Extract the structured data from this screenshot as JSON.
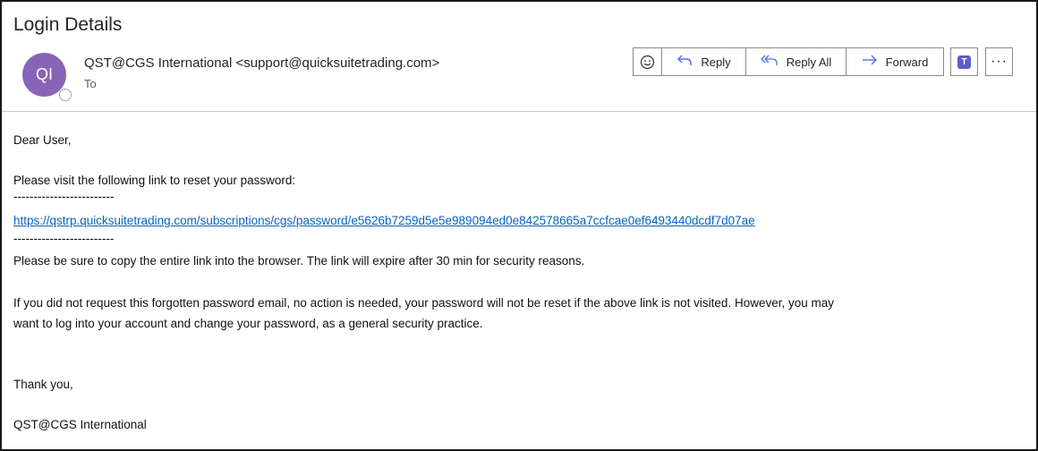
{
  "email": {
    "subject": "Login Details",
    "sender": {
      "initials": "QI",
      "display": "QST@CGS International <support@quicksuitetrading.com>",
      "avatar_color": "#8764b8"
    },
    "to_label": "To"
  },
  "toolbar": {
    "reply": "Reply",
    "reply_all": "Reply All",
    "forward": "Forward",
    "more": "···"
  },
  "icons": {
    "emoji": "smiley-icon",
    "reply": "reply-arrow-icon",
    "reply_all": "reply-all-arrow-icon",
    "forward": "forward-arrow-icon",
    "teams": "teams-icon",
    "more": "more-options-icon"
  },
  "body": {
    "greeting": "Dear User,",
    "instruction": "Please visit the following link to reset your password:",
    "separator": "-------------------------",
    "link": "https://qstrp.quicksuitetrading.com/subscriptions/cgs/password/e5626b7259d5e5e989094ed0e842578665a7ccfcae0ef6493440dcdf7d07ae",
    "expiry_note": "Please be sure to copy the entire link into the browser. The link will expire after 30 min for security reasons.",
    "disclaimer_line1": "If you did not request this forgotten password email, no action is needed, your password will not be reset if the above link is not visited. However, you may",
    "disclaimer_line2": "want to log into your account and change your password, as a general security practice.",
    "thanks": "Thank you,",
    "signature": "QST@CGS International"
  },
  "colors": {
    "accent": "#4f6bed",
    "link": "#0563c1",
    "teams": "#5b5fc7"
  }
}
